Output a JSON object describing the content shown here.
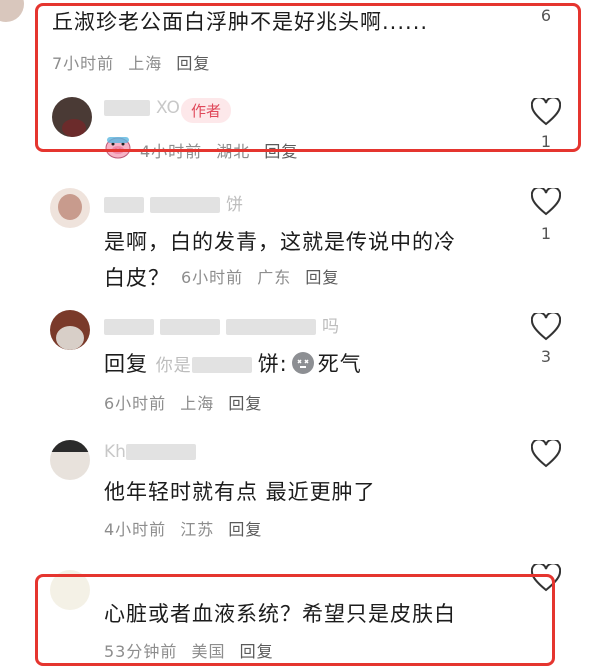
{
  "comment1": {
    "text": "丘淑珍老公面白浮肿不是好兆头啊......",
    "time": "7小时前",
    "location": "上海",
    "reply": "回复",
    "like_count": "6"
  },
  "reply1": {
    "name_fragment": "XO",
    "badge": "作者",
    "time": "4小时前",
    "location": "湖北",
    "reply": "回复",
    "like_count": "1"
  },
  "comment2": {
    "name_fragment": "饼",
    "line1": "是啊，白的发青，这就是传说中的冷",
    "line2": "白皮？",
    "time": "6小时前",
    "location": "广东",
    "reply": "回复",
    "like_count": "1"
  },
  "comment3": {
    "name_fragment": "吗",
    "reply_prefix": "回复",
    "reply_to_fragment": "你是",
    "reply_to_end": "饼:",
    "text_after_emoji": "死气",
    "emoji": "dead-face-emoji",
    "time": "6小时前",
    "location": "上海",
    "reply": "回复",
    "like_count": "3"
  },
  "comment4": {
    "name_fragment": "Kh",
    "text": "他年轻时就有点 最近更肿了",
    "time": "4小时前",
    "location": "江苏",
    "reply": "回复"
  },
  "comment5": {
    "text": "心脏或者血液系统？希望只是皮肤白",
    "time": "53分钟前",
    "location": "美国",
    "reply": "回复"
  },
  "colors": {
    "highlight": "#e5352f",
    "badge_bg": "#fde8ea",
    "badge_text": "#e0485a"
  }
}
